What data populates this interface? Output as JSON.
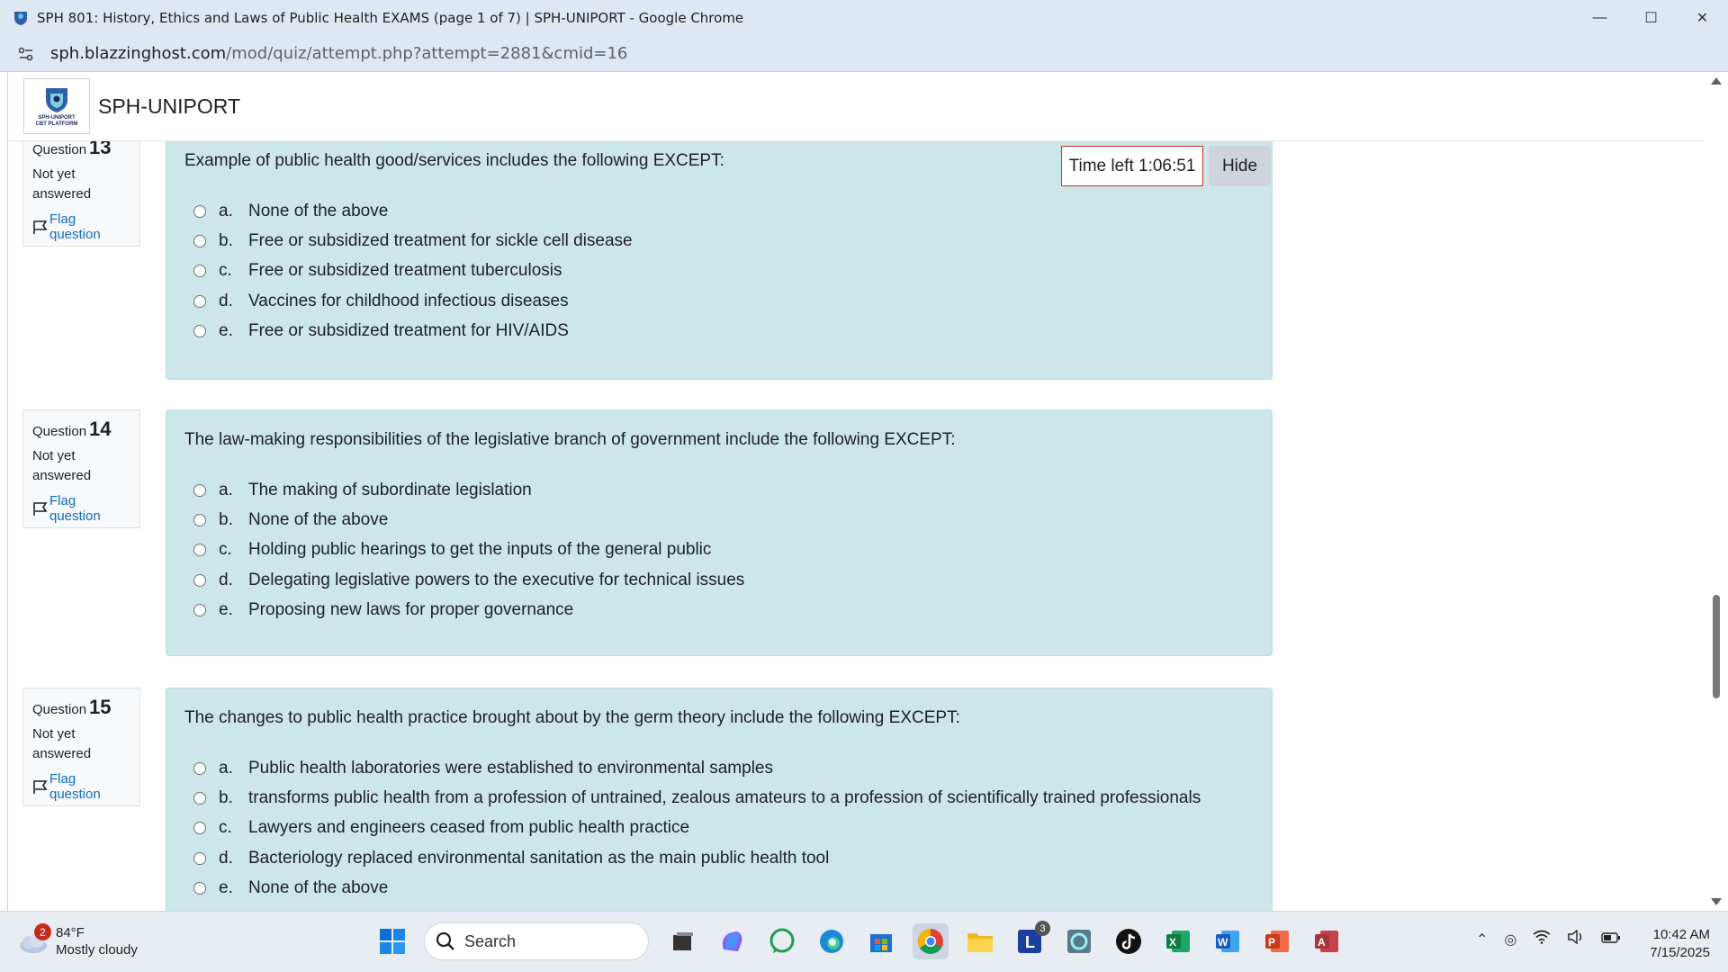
{
  "browser": {
    "window_title": "SPH 801: History, Ethics and Laws of Public Health EXAMS (page 1 of 7) | SPH-UNIPORT - Google Chrome",
    "url_host": "sph.blazzinghost.com",
    "url_path": "/mod/quiz/attempt.php?attempt=2881&cmid=16"
  },
  "site": {
    "name": "SPH-UNIPORT",
    "logo_line1": "SPH-UNIPORT",
    "logo_line2": "CBT PLATFORM"
  },
  "timer": {
    "text": "Time left 1:06:51",
    "hide_label": "Hide"
  },
  "questions": [
    {
      "label": "Question",
      "number": "13",
      "state": "Not yet answered",
      "flag_label": "Flag question",
      "text": "Example of public health good/services includes the following EXCEPT:",
      "answers": [
        {
          "letter": "a.",
          "text": "None of the above"
        },
        {
          "letter": "b.",
          "text": "Free or subsidized treatment for sickle cell disease"
        },
        {
          "letter": "c.",
          "text": "Free or subsidized treatment tuberculosis"
        },
        {
          "letter": "d.",
          "text": "Vaccines for childhood infectious diseases"
        },
        {
          "letter": "e.",
          "text": "Free or subsidized treatment for HIV/AIDS"
        }
      ]
    },
    {
      "label": "Question",
      "number": "14",
      "state": "Not yet answered",
      "flag_label": "Flag question",
      "text": "The law-making responsibilities of the legislative branch of government include the following EXCEPT:",
      "answers": [
        {
          "letter": "a.",
          "text": "The making of subordinate legislation"
        },
        {
          "letter": "b.",
          "text": "None of the above"
        },
        {
          "letter": "c.",
          "text": "Holding public hearings to get the inputs of the general public"
        },
        {
          "letter": "d.",
          "text": "Delegating legislative powers to the executive for technical issues"
        },
        {
          "letter": "e.",
          "text": "Proposing new laws for proper governance"
        }
      ]
    },
    {
      "label": "Question",
      "number": "15",
      "state": "Not yet answered",
      "flag_label": "Flag question",
      "text": "The changes to public health practice brought about by the germ theory include the following EXCEPT:",
      "answers": [
        {
          "letter": "a.",
          "text": "Public health laboratories were established to environmental samples"
        },
        {
          "letter": "b.",
          "text": "transforms public health from a profession of untrained, zealous amateurs to a profession of scientifically trained professionals"
        },
        {
          "letter": "c.",
          "text": "Lawyers and engineers ceased from public health practice"
        },
        {
          "letter": "d.",
          "text": "Bacteriology replaced environmental sanitation as the main public health tool"
        },
        {
          "letter": "e.",
          "text": "None of the above"
        }
      ]
    }
  ],
  "taskbar": {
    "weather_temp": "84°F",
    "weather_desc": "Mostly cloudy",
    "weather_badge": "2",
    "search_label": "Search",
    "l_badge": "3",
    "time": "10:42 AM",
    "date": "7/15/2025"
  }
}
